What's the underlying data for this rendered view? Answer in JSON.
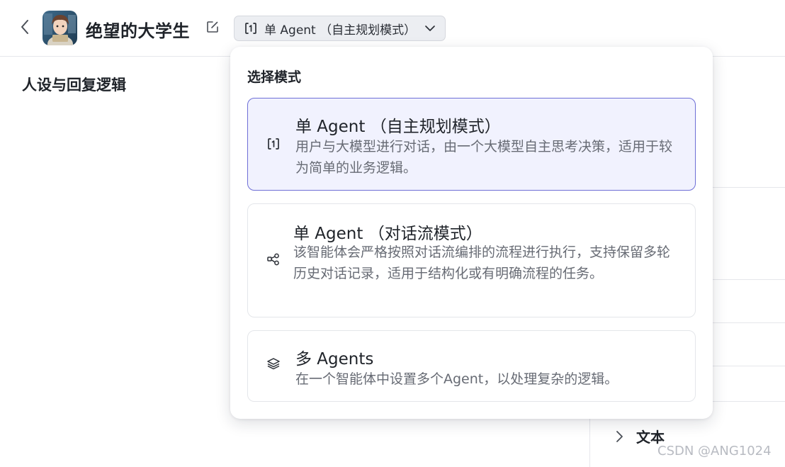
{
  "header": {
    "back_icon": "chevron-left-icon",
    "avatar_alt": "avatar",
    "bot_name": "绝望的大学生",
    "edit_icon": "edit-icon",
    "mode_selector": {
      "label": "单 Agent （自主规划模式）",
      "icon": "single-agent-icon",
      "chevron": "chevron-down-icon"
    }
  },
  "left": {
    "section_title": "人设与回复逻辑"
  },
  "right": {
    "text_label": "文本"
  },
  "popup": {
    "title": "选择模式",
    "options": [
      {
        "icon": "single-agent-icon",
        "title": "单 Agent （自主规划模式）",
        "description": "用户与大模型进行对话，由一个大模型自主思考决策，适用于较为简单的业务逻辑。",
        "selected": true
      },
      {
        "icon": "workflow-icon",
        "title": "单 Agent （对话流模式）",
        "description": "该智能体会严格按照对话流编排的流程进行执行，支持保留多轮历史对话记录，适用于结构化或有明确流程的任务。",
        "selected": false
      },
      {
        "icon": "layers-icon",
        "title": "多 Agents",
        "description": "在一个智能体中设置多个Agent，以处理复杂的逻辑。",
        "selected": false
      }
    ]
  },
  "watermark": "CSDN @ANG1024",
  "colors": {
    "accent": "#6e6fd6",
    "selected_bg": "#f1f2fe",
    "text_primary": "#1f2329",
    "text_secondary": "#676b74"
  }
}
